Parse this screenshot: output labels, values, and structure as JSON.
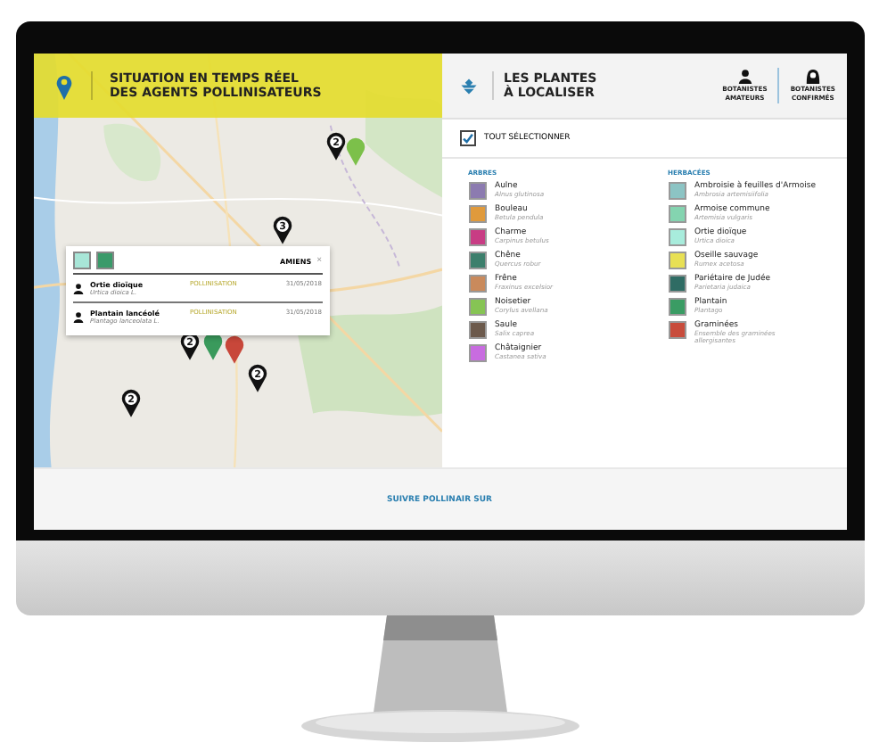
{
  "map_header": {
    "title_line_1": "SITUATION EN TEMPS RÉEL",
    "title_line_2": "DES AGENTS POLLINISATEURS"
  },
  "map": {
    "markers": [
      {
        "kind": "count",
        "count": "2",
        "color": "#111111"
      },
      {
        "kind": "plain",
        "color": "#7cc04a"
      },
      {
        "kind": "count",
        "count": "3",
        "color": "#111111"
      },
      {
        "kind": "plain",
        "color": "#3a9a5c"
      },
      {
        "kind": "plain",
        "color": "#c8473a"
      },
      {
        "kind": "count",
        "count": "2",
        "color": "#111111"
      },
      {
        "kind": "count",
        "count": "2",
        "color": "#111111"
      },
      {
        "kind": "count",
        "count": "2",
        "color": "#111111"
      }
    ]
  },
  "popup": {
    "swatches": [
      {
        "color": "#a8e6d8"
      },
      {
        "color": "#3a9a6a"
      }
    ],
    "place": "AMIENS",
    "close": "×",
    "rows": [
      {
        "name": "Ortie dioïque",
        "latin": "Urtica dioica L.",
        "status": "POLLINISATION",
        "date": "31/05/2018"
      },
      {
        "name": "Plantain lancéolé",
        "latin": "Plantago lanceolata L.",
        "status": "POLLINISATION",
        "date": "31/05/2018"
      }
    ]
  },
  "panel": {
    "title_line_1": "LES PLANTES",
    "title_line_2": "À LOCALISER",
    "buttons": [
      {
        "kind": "amateur",
        "label_1": "BOTANISTES",
        "label_2": "AMATEURS"
      },
      {
        "kind": "expert",
        "label_1": "BOTANISTES",
        "label_2": "CONFIRMÉS"
      }
    ],
    "select_all": {
      "label": "TOUT SÉLECTIONNER",
      "checked": true
    }
  },
  "legend": [
    {
      "heading": "ARBRES",
      "items": [
        {
          "name": "Aulne",
          "latin": "Alnus glutinosa",
          "color": "#8c7bb0"
        },
        {
          "name": "Bouleau",
          "latin": "Betula pendula",
          "color": "#e09a3c"
        },
        {
          "name": "Charme",
          "latin": "Carpinus betulus",
          "color": "#c83c84"
        },
        {
          "name": "Chêne",
          "latin": "Quercus robur",
          "color": "#3c7f6c"
        },
        {
          "name": "Frêne",
          "latin": "Fraxinus excelsior",
          "color": "#c98a5c"
        },
        {
          "name": "Noisetier",
          "latin": "Corylus avellana",
          "color": "#86c454"
        },
        {
          "name": "Saule",
          "latin": "Salix caprea",
          "color": "#6c5a4c"
        },
        {
          "name": "Châtaignier",
          "latin": "Castanea sativa",
          "color": "#c86ce0"
        }
      ]
    },
    {
      "heading": "HERBACÉES",
      "items": [
        {
          "name": "Ambroisie à feuilles d'Armoise",
          "latin": "Ambrosia artemisiifolia",
          "color": "#8cc4c4"
        },
        {
          "name": "Armoise commune",
          "latin": "Artemisia vulgaris",
          "color": "#84d4b0"
        },
        {
          "name": "Ortie dioïque",
          "latin": "Urtica dioica",
          "color": "#a8ecdc"
        },
        {
          "name": "Oseille sauvage",
          "latin": "Rumex acetosa",
          "color": "#e8e054"
        },
        {
          "name": "Pariétaire de Judée",
          "latin": "Parietaria judaica",
          "color": "#2f6c64"
        },
        {
          "name": "Plantain",
          "latin": "Plantago",
          "color": "#3a9c64"
        },
        {
          "name": "Graminées",
          "latin": "Ensemble des graminées allergisantes",
          "color": "#c84c3c"
        }
      ]
    }
  ],
  "footer": {
    "label": "SUIVRE POLLINAIR SUR"
  }
}
